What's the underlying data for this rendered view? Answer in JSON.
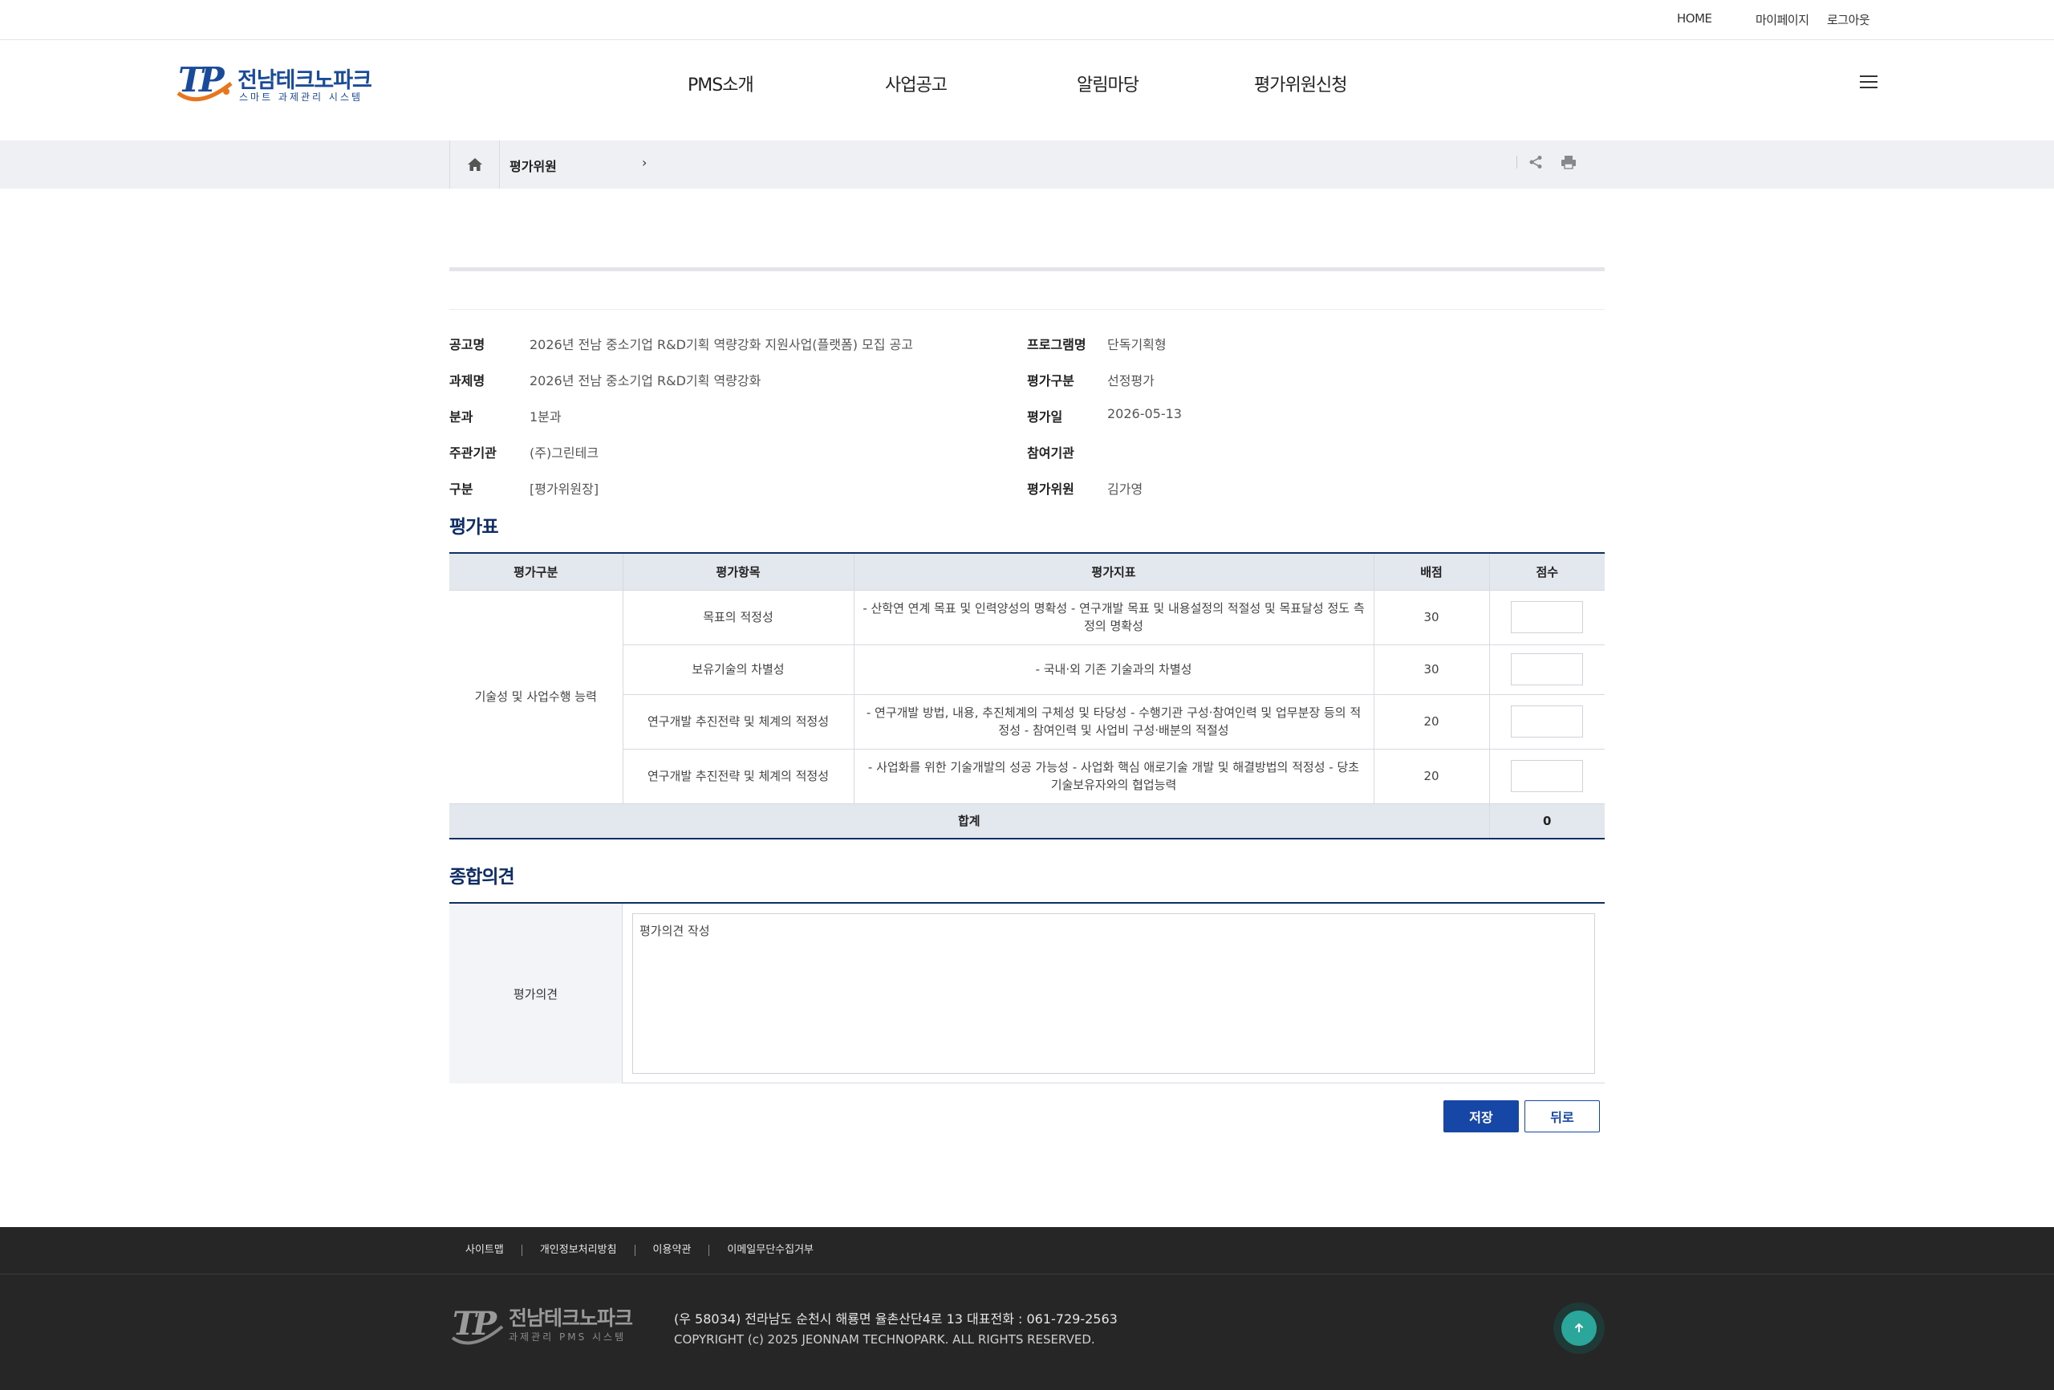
{
  "topbar": {
    "home": "HOME",
    "mypage": "마이페이지",
    "logout": "로그아웃"
  },
  "header": {
    "logo_title": "전남테크노파크",
    "logo_sub": "스마트 과제관리 시스템",
    "nav": [
      "PMS소개",
      "사업공고",
      "알림마당",
      "평가위원신청"
    ]
  },
  "breadcrumb": {
    "current": "평가위원",
    "arrow": "›"
  },
  "info": {
    "left": [
      {
        "k": "공고명",
        "v": "2026년 전남 중소기업 R&D기획 역량강화 지원사업(플랫폼) 모집 공고"
      },
      {
        "k": "과제명",
        "v": "2026년 전남 중소기업 R&D기획 역량강화"
      },
      {
        "k": "분과",
        "v": "1분과"
      },
      {
        "k": "주관기관",
        "v": "(주)그린테크"
      },
      {
        "k": "구분",
        "v": "[평가위원장]"
      }
    ],
    "right": [
      {
        "k": "프로그램명",
        "v": "단독기획형"
      },
      {
        "k": "평가구분",
        "v": "선정평가"
      },
      {
        "k": "평가일",
        "v": "2026-05-13"
      },
      {
        "k": "참여기관",
        "v": ""
      },
      {
        "k": "평가위원",
        "v": "김가영"
      }
    ]
  },
  "eval_table": {
    "title": "평가표",
    "headers": [
      "평가구분",
      "평가항목",
      "평가지표",
      "배점",
      "점수"
    ],
    "category": "기술성 및 사업수행 능력",
    "rows": [
      {
        "item": "목표의 적정성",
        "indicator": "- 산학연 연계 목표 및 인력양성의 명확성 - 연구개발 목표 및 내용설정의 적절성 및 목표달성 정도 측정의 명확성",
        "points": "30",
        "score": ""
      },
      {
        "item": "보유기술의 차별성",
        "indicator": "- 국내·외 기존 기술과의 차별성",
        "points": "30",
        "score": ""
      },
      {
        "item": "연구개발 추진전략 및 체계의 적정성",
        "indicator": "- 연구개발 방법, 내용, 추진체계의 구체성 및 타당성 - 수행기관 구성·참여인력 및 업무분장 등의 적정성 - 참여인력 및 사업비 구성·배분의 적절성",
        "points": "20",
        "score": ""
      },
      {
        "item": "연구개발 추진전략 및 체계의 적정성",
        "indicator": "- 사업화를 위한 기술개발의 성공 가능성 - 사업화 핵심 애로기술 개발 및 해결방법의 적정성 - 당초 기술보유자와의 협업능력",
        "points": "20",
        "score": ""
      }
    ],
    "sum_label": "합계",
    "sum_value": "0"
  },
  "opinion": {
    "title": "종합의견",
    "label": "평가의견",
    "placeholder": "평가의견 작성"
  },
  "buttons": {
    "save": "저장",
    "back": "뒤로"
  },
  "footer": {
    "links": [
      "사이트맵",
      "개인정보처리방침",
      "이용약관",
      "이메일무단수집거부"
    ],
    "logo_title": "전남테크노파크",
    "logo_sub": "과제관리 PMS 시스템",
    "address": "(우 58034) 전라남도 순천시 해룡면 율촌산단4로 13   대표전화 : 061-729-2563",
    "copyright": "COPYRIGHT (c) 2025 JEONNAM TECHNOPARK. ALL RIGHTS RESERVED."
  },
  "colors": {
    "brand": "#1a4a9a",
    "navy": "#0f2d66",
    "button": "#1646a6",
    "footer": "#262626",
    "top_button": "#2aa79a"
  }
}
